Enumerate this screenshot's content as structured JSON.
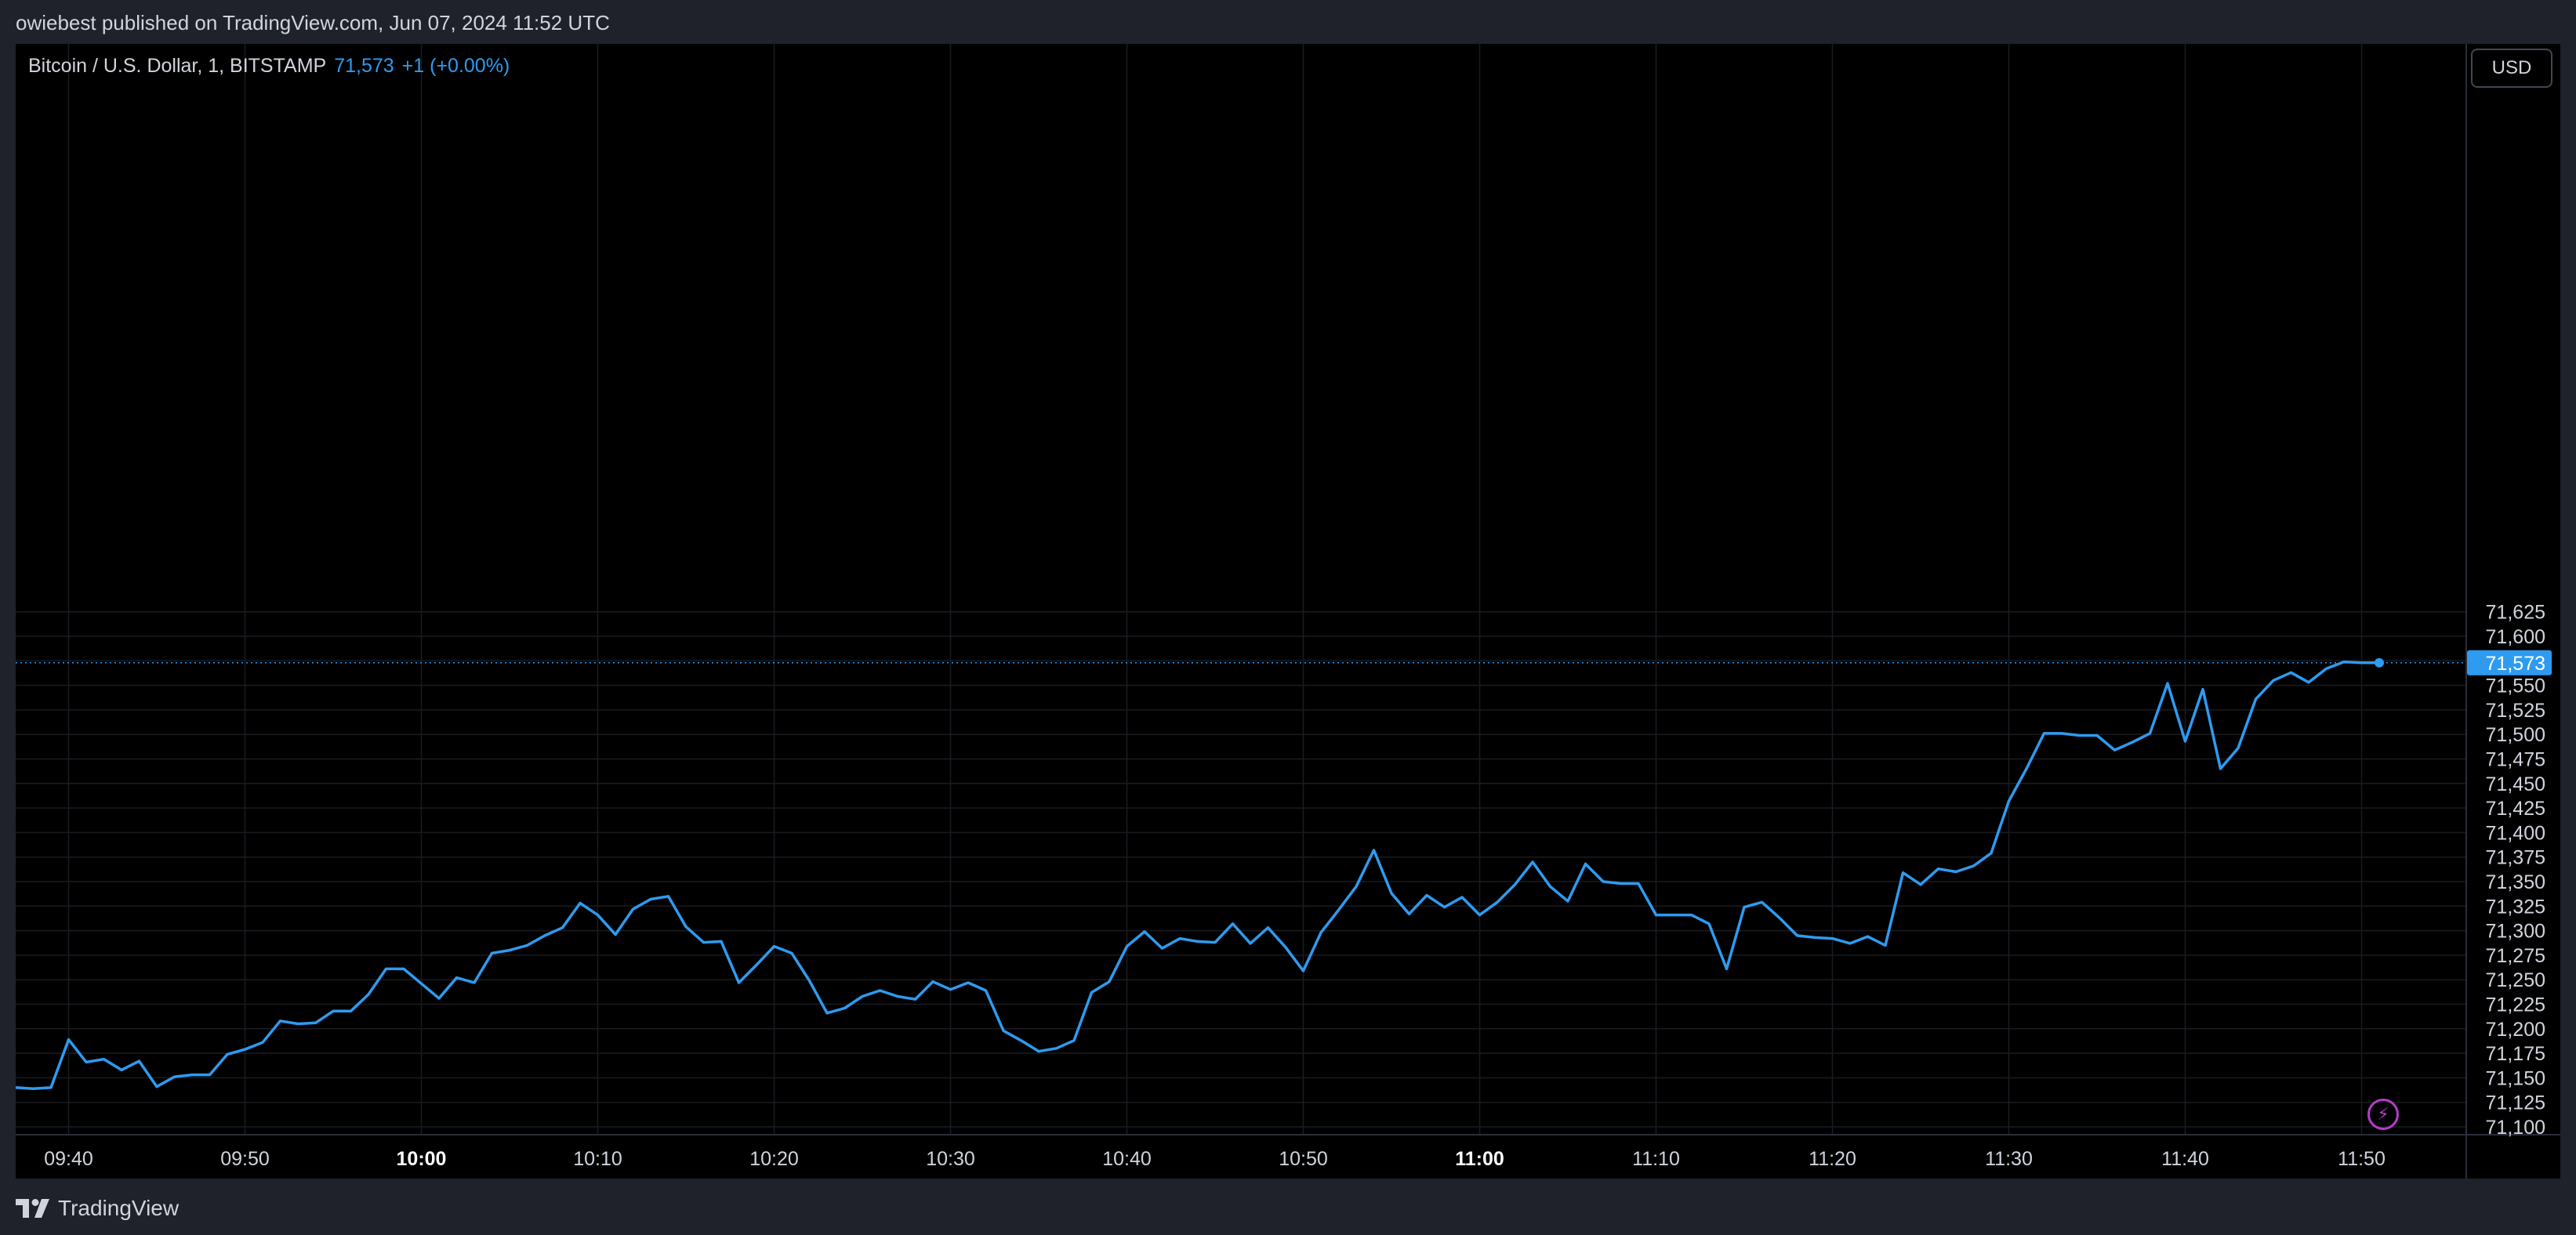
{
  "header": {
    "published_text": "owiebest published on TradingView.com, Jun 07, 2024 11:52 UTC"
  },
  "legend": {
    "symbol": "Bitcoin / U.S. Dollar, 1, BITSTAMP",
    "price": "71,573",
    "change": "+1 (+0.00%)"
  },
  "currency_button": "USD",
  "footer": {
    "brand": "TradingView"
  },
  "colors": {
    "line": "#2e9bf0",
    "background": "#000000",
    "grid": "#1a1c22",
    "text": "#d1d4dc",
    "price_tag": "#2e9bf0",
    "alert_icon": "#b63cc7"
  },
  "chart_data": {
    "type": "line",
    "grid": true,
    "x_unit": "minute",
    "x_start": "09:37",
    "x_ticks": [
      "09:40",
      "09:50",
      "10:00",
      "10:10",
      "10:20",
      "10:30",
      "10:40",
      "10:50",
      "11:00",
      "11:10",
      "11:20",
      "11:30",
      "11:40",
      "11:50"
    ],
    "x_ticks_bold": [
      "10:00",
      "11:00"
    ],
    "y_ticks": [
      71100,
      71125,
      71150,
      71175,
      71200,
      71225,
      71250,
      71275,
      71300,
      71325,
      71350,
      71375,
      71400,
      71425,
      71450,
      71475,
      71500,
      71525,
      71550,
      71575,
      71600,
      71625
    ],
    "ylim": [
      71098,
      71625
    ],
    "last_price": 71573,
    "last_price_label": "71,573",
    "values": [
      71140,
      71139,
      71140,
      71189,
      71166,
      71169,
      71158,
      71167,
      71141,
      71151,
      71153,
      71153,
      71174,
      71179,
      71186,
      71208,
      71205,
      71206,
      71218,
      71218,
      71235,
      71261,
      71261,
      71246,
      71231,
      71252,
      71247,
      71277,
      71280,
      71285,
      71295,
      71303,
      71328,
      71316,
      71296,
      71322,
      71332,
      71335,
      71304,
      71288,
      71289,
      71247,
      71265,
      71284,
      71277,
      71249,
      71216,
      71221,
      71233,
      71239,
      71233,
      71230,
      71248,
      71240,
      71247,
      71239,
      71198,
      71188,
      71177,
      71180,
      71188,
      71237,
      71248,
      71284,
      71299,
      71282,
      71292,
      71289,
      71288,
      71307,
      71287,
      71303,
      71283,
      71259,
      71298,
      71321,
      71345,
      71382,
      71338,
      71317,
      71336,
      71324,
      71334,
      71316,
      71329,
      71347,
      71370,
      71345,
      71330,
      71368,
      71350,
      71348,
      71348,
      71316,
      71316,
      71316,
      71307,
      71261,
      71324,
      71329,
      71313,
      71295,
      71293,
      71292,
      71287,
      71294,
      71285,
      71359,
      71347,
      71363,
      71360,
      71366,
      71379,
      71432,
      71465,
      71501,
      71501,
      71499,
      71499,
      71484,
      71492,
      71501,
      71552,
      71493,
      71546,
      71465,
      71486,
      71536,
      71555,
      71563,
      71553,
      71567,
      71574,
      71573,
      71573
    ]
  }
}
